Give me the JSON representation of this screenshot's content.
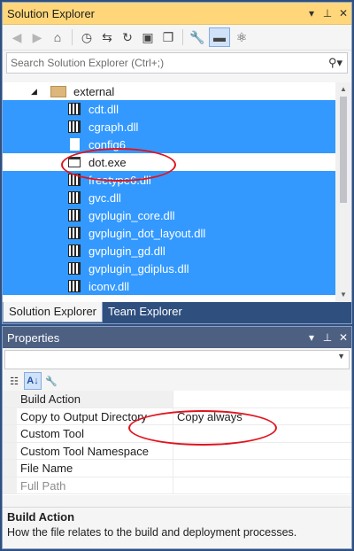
{
  "solution_explorer": {
    "title": "Solution Explorer",
    "title_buttons": [
      "▾",
      "⊥",
      "✕"
    ],
    "search": {
      "placeholder": "Search Solution Explorer (Ctrl+;)"
    },
    "tree": {
      "folder": "external",
      "files": [
        {
          "name": "cdt.dll",
          "icon": "dll-icon",
          "selected": true
        },
        {
          "name": "cgraph.dll",
          "icon": "dll-icon",
          "selected": true
        },
        {
          "name": "config6",
          "icon": "file-icon",
          "selected": true
        },
        {
          "name": "dot.exe",
          "icon": "exe-icon",
          "selected": false
        },
        {
          "name": "freetype6.dll",
          "icon": "dll-icon",
          "selected": true
        },
        {
          "name": "gvc.dll",
          "icon": "dll-icon",
          "selected": true
        },
        {
          "name": "gvplugin_core.dll",
          "icon": "dll-icon",
          "selected": true
        },
        {
          "name": "gvplugin_dot_layout.dll",
          "icon": "dll-icon",
          "selected": true
        },
        {
          "name": "gvplugin_gd.dll",
          "icon": "dll-icon",
          "selected": true
        },
        {
          "name": "gvplugin_gdiplus.dll",
          "icon": "dll-icon",
          "selected": true
        },
        {
          "name": "iconv.dll",
          "icon": "dll-icon",
          "selected": true
        }
      ]
    },
    "tabs": [
      "Solution Explorer",
      "Team Explorer"
    ]
  },
  "properties": {
    "title": "Properties",
    "title_buttons": [
      "▾",
      "⊥",
      "✕"
    ],
    "rows": [
      {
        "name": "Build Action",
        "value": ""
      },
      {
        "name": "Copy to Output Directory",
        "value": "Copy always"
      },
      {
        "name": "Custom Tool",
        "value": ""
      },
      {
        "name": "Custom Tool Namespace",
        "value": ""
      },
      {
        "name": "File Name",
        "value": ""
      },
      {
        "name": "Full Path",
        "value": ""
      }
    ],
    "description": {
      "title": "Build Action",
      "text": "How the file relates to the build and deployment processes."
    }
  },
  "colors": {
    "selection": "#3399ff",
    "active_title": "#ffd77a",
    "annotation": "#e0141e"
  }
}
